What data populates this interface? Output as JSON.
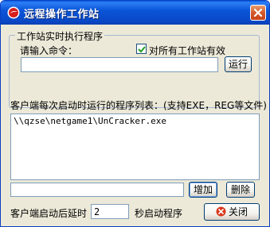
{
  "window": {
    "title": "远程操作工作站"
  },
  "group": {
    "legend": "工作站实时执行程序",
    "command_label": "请输入命令：",
    "all_stations_label": "对所有工作站有效",
    "all_stations_checked": true,
    "command_value": "",
    "run_label": "运行"
  },
  "startup": {
    "list_label": "客户端每次启动时运行的程序列表：(支持EXE，REG等文件)",
    "items": [
      "\\\\qzse\\netgame1\\UnCracker.exe"
    ],
    "new_item_value": "",
    "add_label": "增加",
    "delete_label": "删除"
  },
  "footer": {
    "delay_label_before": "客户端启动后延时",
    "delay_value": "2",
    "delay_label_after": "秒启动程序",
    "close_label": "关闭"
  },
  "colors": {
    "title_bar": "#0a55d8",
    "close_button": "#d4582c",
    "dialog_bg": "#ece9d8"
  },
  "icons": {
    "app": "app-logo-icon",
    "close": "close-icon",
    "check": "checkmark-icon"
  }
}
